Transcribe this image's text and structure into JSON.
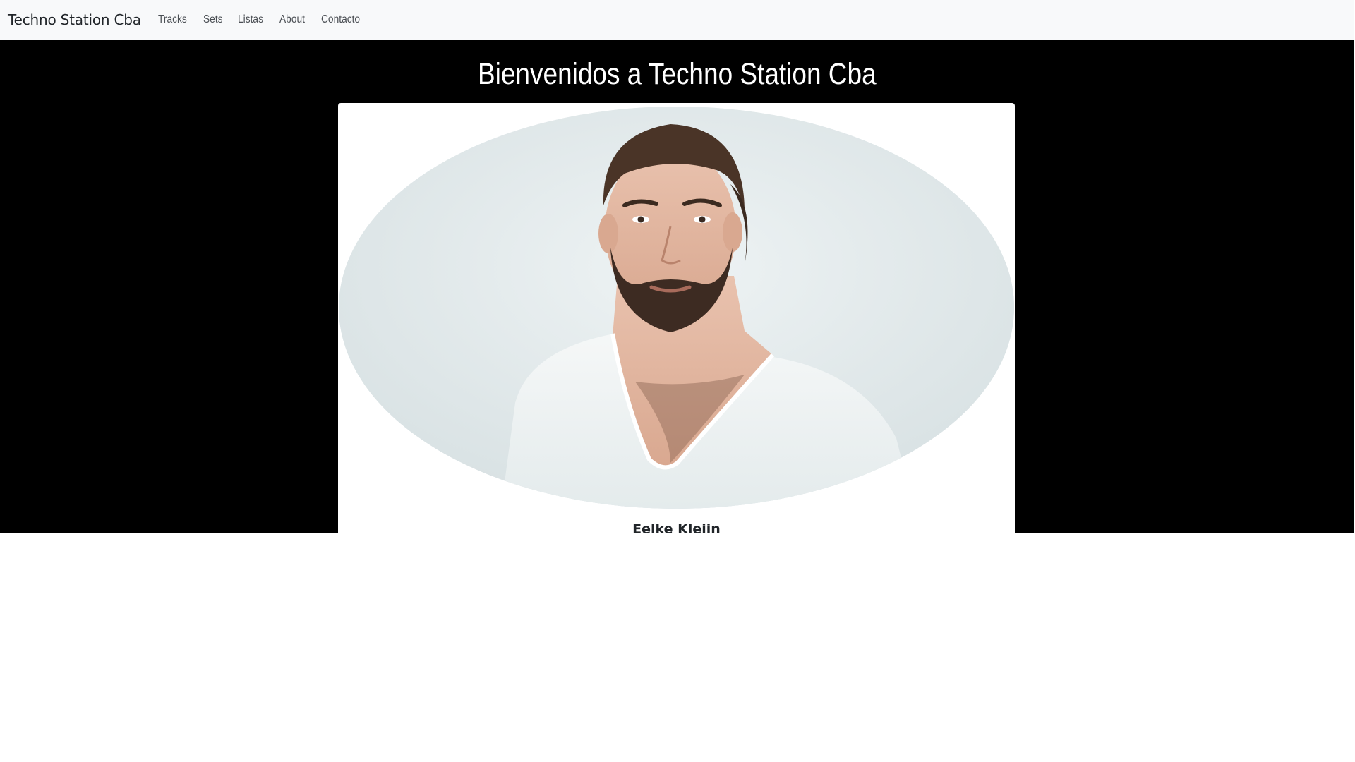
{
  "navbar": {
    "brand": "Techno Station Cba",
    "links": [
      "Tracks",
      "Sets",
      "Listas",
      "About",
      "Contacto"
    ]
  },
  "hero": {
    "title": "Bienvenidos a Techno Station Cba"
  },
  "card": {
    "image_alt": "Portrait of a bearded man in a white v-neck t-shirt",
    "title": "Eelke Kleijn"
  },
  "colors": {
    "navbar_bg": "#f8f9fa",
    "hero_bg": "#000000",
    "hero_text": "#ffffff",
    "card_bg": "#ffffff",
    "photo_bg": "#e2eaec"
  }
}
